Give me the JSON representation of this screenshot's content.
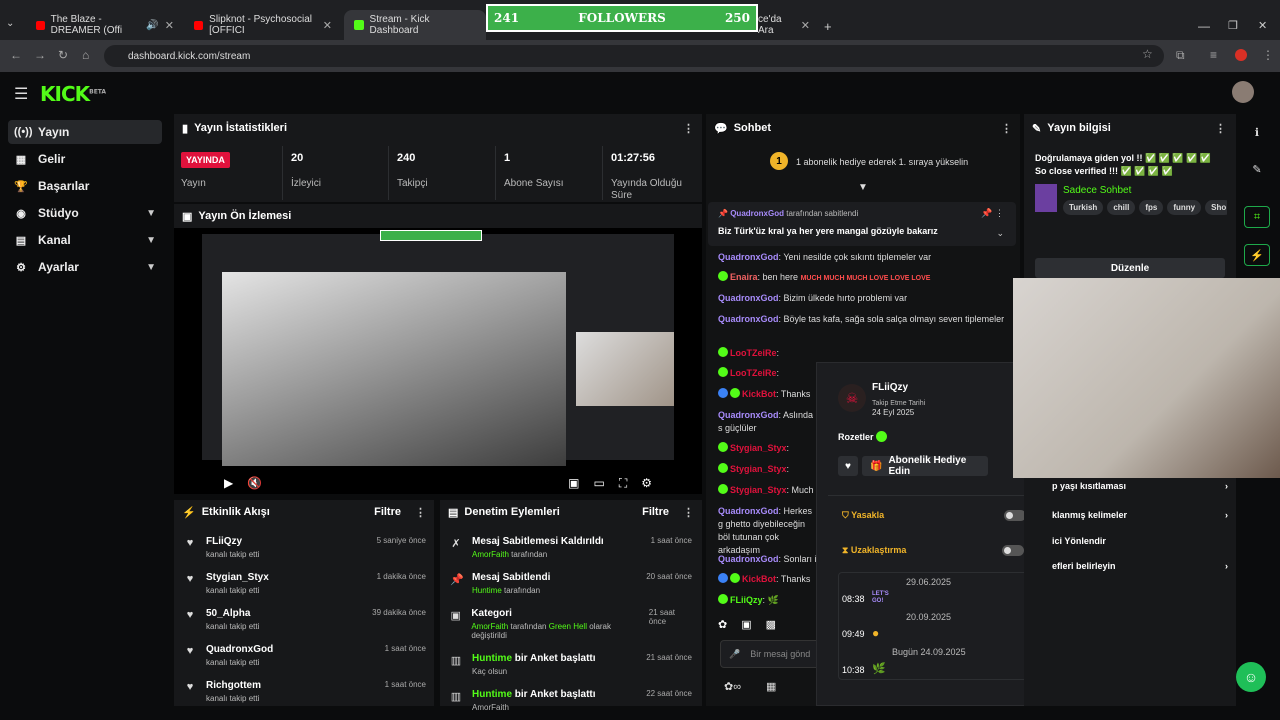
{
  "browser": {
    "tabs": [
      {
        "label": "The Blaze - DREAMER (Offi",
        "active": false
      },
      {
        "label": "Slipknot - Psychosocial [OFFICI",
        "active": false
      },
      {
        "label": "Stream - Kick Dashboard",
        "active": true
      },
      {
        "label": "ce'da Ara",
        "active": false
      }
    ],
    "url": "dashboard.kick.com/stream"
  },
  "overlay": {
    "followers_left": "241",
    "followers_label": "FOLLOWERS",
    "followers_right": "250"
  },
  "app": {
    "logo": "KICK",
    "logo_sup": "BETA"
  },
  "sidebar": {
    "items": [
      {
        "label": "Yayın",
        "icon": "broadcast-icon",
        "active": true
      },
      {
        "label": "Gelir",
        "icon": "revenue-icon"
      },
      {
        "label": "Başarılar",
        "icon": "trophy-icon"
      },
      {
        "label": "Stüdyo",
        "icon": "studio-icon",
        "chevron": true
      },
      {
        "label": "Kanal",
        "icon": "channel-icon",
        "chevron": true
      },
      {
        "label": "Ayarlar",
        "icon": "gear-icon",
        "chevron": true
      }
    ]
  },
  "stats": {
    "title": "Yayın İstatistikleri",
    "live_badge": "YAYINDA",
    "live_label": "Yayın",
    "items": [
      {
        "value": "20",
        "label": "İzleyici"
      },
      {
        "value": "240",
        "label": "Takipçi"
      },
      {
        "value": "1",
        "label": "Abone Sayısı"
      },
      {
        "value": "01:27:56",
        "label": "Yayında Olduğu Süre"
      }
    ]
  },
  "preview": {
    "title": "Yayın Ön İzlemesi"
  },
  "activity": {
    "title": "Etkinlik Akışı",
    "filter": "Filtre",
    "items": [
      {
        "name": "FLiiQzy",
        "desc": "kanalı takip etti",
        "time": "5 saniye önce"
      },
      {
        "name": "Stygian_Styx",
        "desc": "kanalı takip etti",
        "time": "1 dakika önce"
      },
      {
        "name": "50_Alpha",
        "desc": "kanalı takip etti",
        "time": "39 dakika önce"
      },
      {
        "name": "QuadronxGod",
        "desc": "kanalı takip etti",
        "time": "1 saat önce"
      },
      {
        "name": "Richgottem",
        "desc": "kanalı takip etti",
        "time": "1 saat önce"
      }
    ]
  },
  "moderation": {
    "title": "Denetim Eylemleri",
    "filter": "Filtre",
    "items": [
      {
        "action": "Mesaj Sabitlemesi Kaldırıldı",
        "user": "AmorFaith",
        "suffix": "tarafından",
        "time": "1 saat önce"
      },
      {
        "action": "Mesaj Sabitlendi",
        "user": "Huntime",
        "suffix": "tarafından",
        "time": "20 saat önce"
      },
      {
        "action": "Kategori",
        "user": "AmorFaith",
        "suffix": "tarafından",
        "extra_user": "Green Hell",
        "extra_suffix": "olarak değiştirildi",
        "time": "21 saat önce"
      },
      {
        "prefix_user": "Huntime",
        "action": "bir Anket başlattı",
        "detail": "Kaç olsun",
        "time": "21 saat önce"
      },
      {
        "prefix_user": "Huntime",
        "action": "bir Anket başlattı",
        "detail": "AmorFaith",
        "time": "22 saat önce"
      }
    ]
  },
  "chat": {
    "title": "Sohbet",
    "goal_badge": "1",
    "goal_text": "1 abonelik hediye ederek 1. sıraya yükselin",
    "pinned_by": "QuadronxGod",
    "pinned_suffix": "tarafından sabitlendi",
    "pinned_msg": "Biz Türk'üz kral ya her yere mangal gözüyle bakarız",
    "input_placeholder": "Bir mesaj gönd",
    "messages": [
      {
        "user": "QuadronxGod",
        "text": "Yeni nesilde çok sıkıntı tiplemeler var"
      },
      {
        "user": "Enaira",
        "text": "ben here",
        "emote": "MUCH MUCH MUCH LOVE LOVE LOVE"
      },
      {
        "user": "QuadronxGod",
        "text": "Bizim ülkede hırto problemi var"
      },
      {
        "user": "QuadronxGod",
        "text": "Böyle tas kafa, sağa sola salça olmayı seven tiplemeler"
      },
      {
        "user": "LooTZeiRe",
        "text": ""
      },
      {
        "user": "LooTZeiRe",
        "text": ""
      },
      {
        "user": "KickBot",
        "text": "Thanks"
      },
      {
        "user": "QuadronxGod",
        "text": "Aslında s güçlüler"
      },
      {
        "user": "Stygian_Styx",
        "text": ""
      },
      {
        "user": "Stygian_Styx",
        "text": ""
      },
      {
        "user": "Stygian_Styx",
        "text": "Much"
      },
      {
        "user": "QuadronxGod",
        "text": "Herkes g ghetto diyebileceğin böl tutunan çok arkadaşım"
      },
      {
        "user": "QuadronxGod",
        "text": "Sonları i"
      },
      {
        "user": "KickBot",
        "text": "Thanks"
      },
      {
        "user": "FLiiQzy",
        "text": ""
      }
    ]
  },
  "user_card": {
    "username": "FLiiQzy",
    "follow_label": "Takip Etme Tarihi",
    "follow_date": "24 Eyl 2025",
    "badges_label": "Rozetler",
    "gift_button": "Abonelik Hediye Edin",
    "ban_label": "Yasakla",
    "timeout_label": "Uzaklaştırma",
    "history": [
      {
        "date": "29.06.2025",
        "time": "08:38",
        "emote": "LET'S GO!"
      },
      {
        "date": "20.09.2025",
        "time": "09:49",
        "emote": ""
      },
      {
        "date": "Bugün 24.09.2025",
        "time": "10:38",
        "emote": ""
      }
    ]
  },
  "stream_info": {
    "title": "Yayın bilgisi",
    "stream_title": "Doğrulamaya giden yol !! ✅ ✅ ✅ ✅ ✅ So close verified !!! ✅ ✅ ✅ ✅",
    "category": "Sadece Sohbet",
    "tags": [
      "Turkish",
      "chill",
      "fps",
      "funny",
      "Sho"
    ],
    "edit_button": "Düzenle",
    "settings": [
      {
        "label": "p yaşı kısıtlaması"
      },
      {
        "label": "klanmış kelimeler"
      },
      {
        "label": "ici Yönlendir"
      },
      {
        "label": "efleri belirleyin"
      }
    ]
  },
  "colors": {
    "accent": "#53fc18",
    "live": "#e0123c",
    "panel": "#17181a"
  }
}
